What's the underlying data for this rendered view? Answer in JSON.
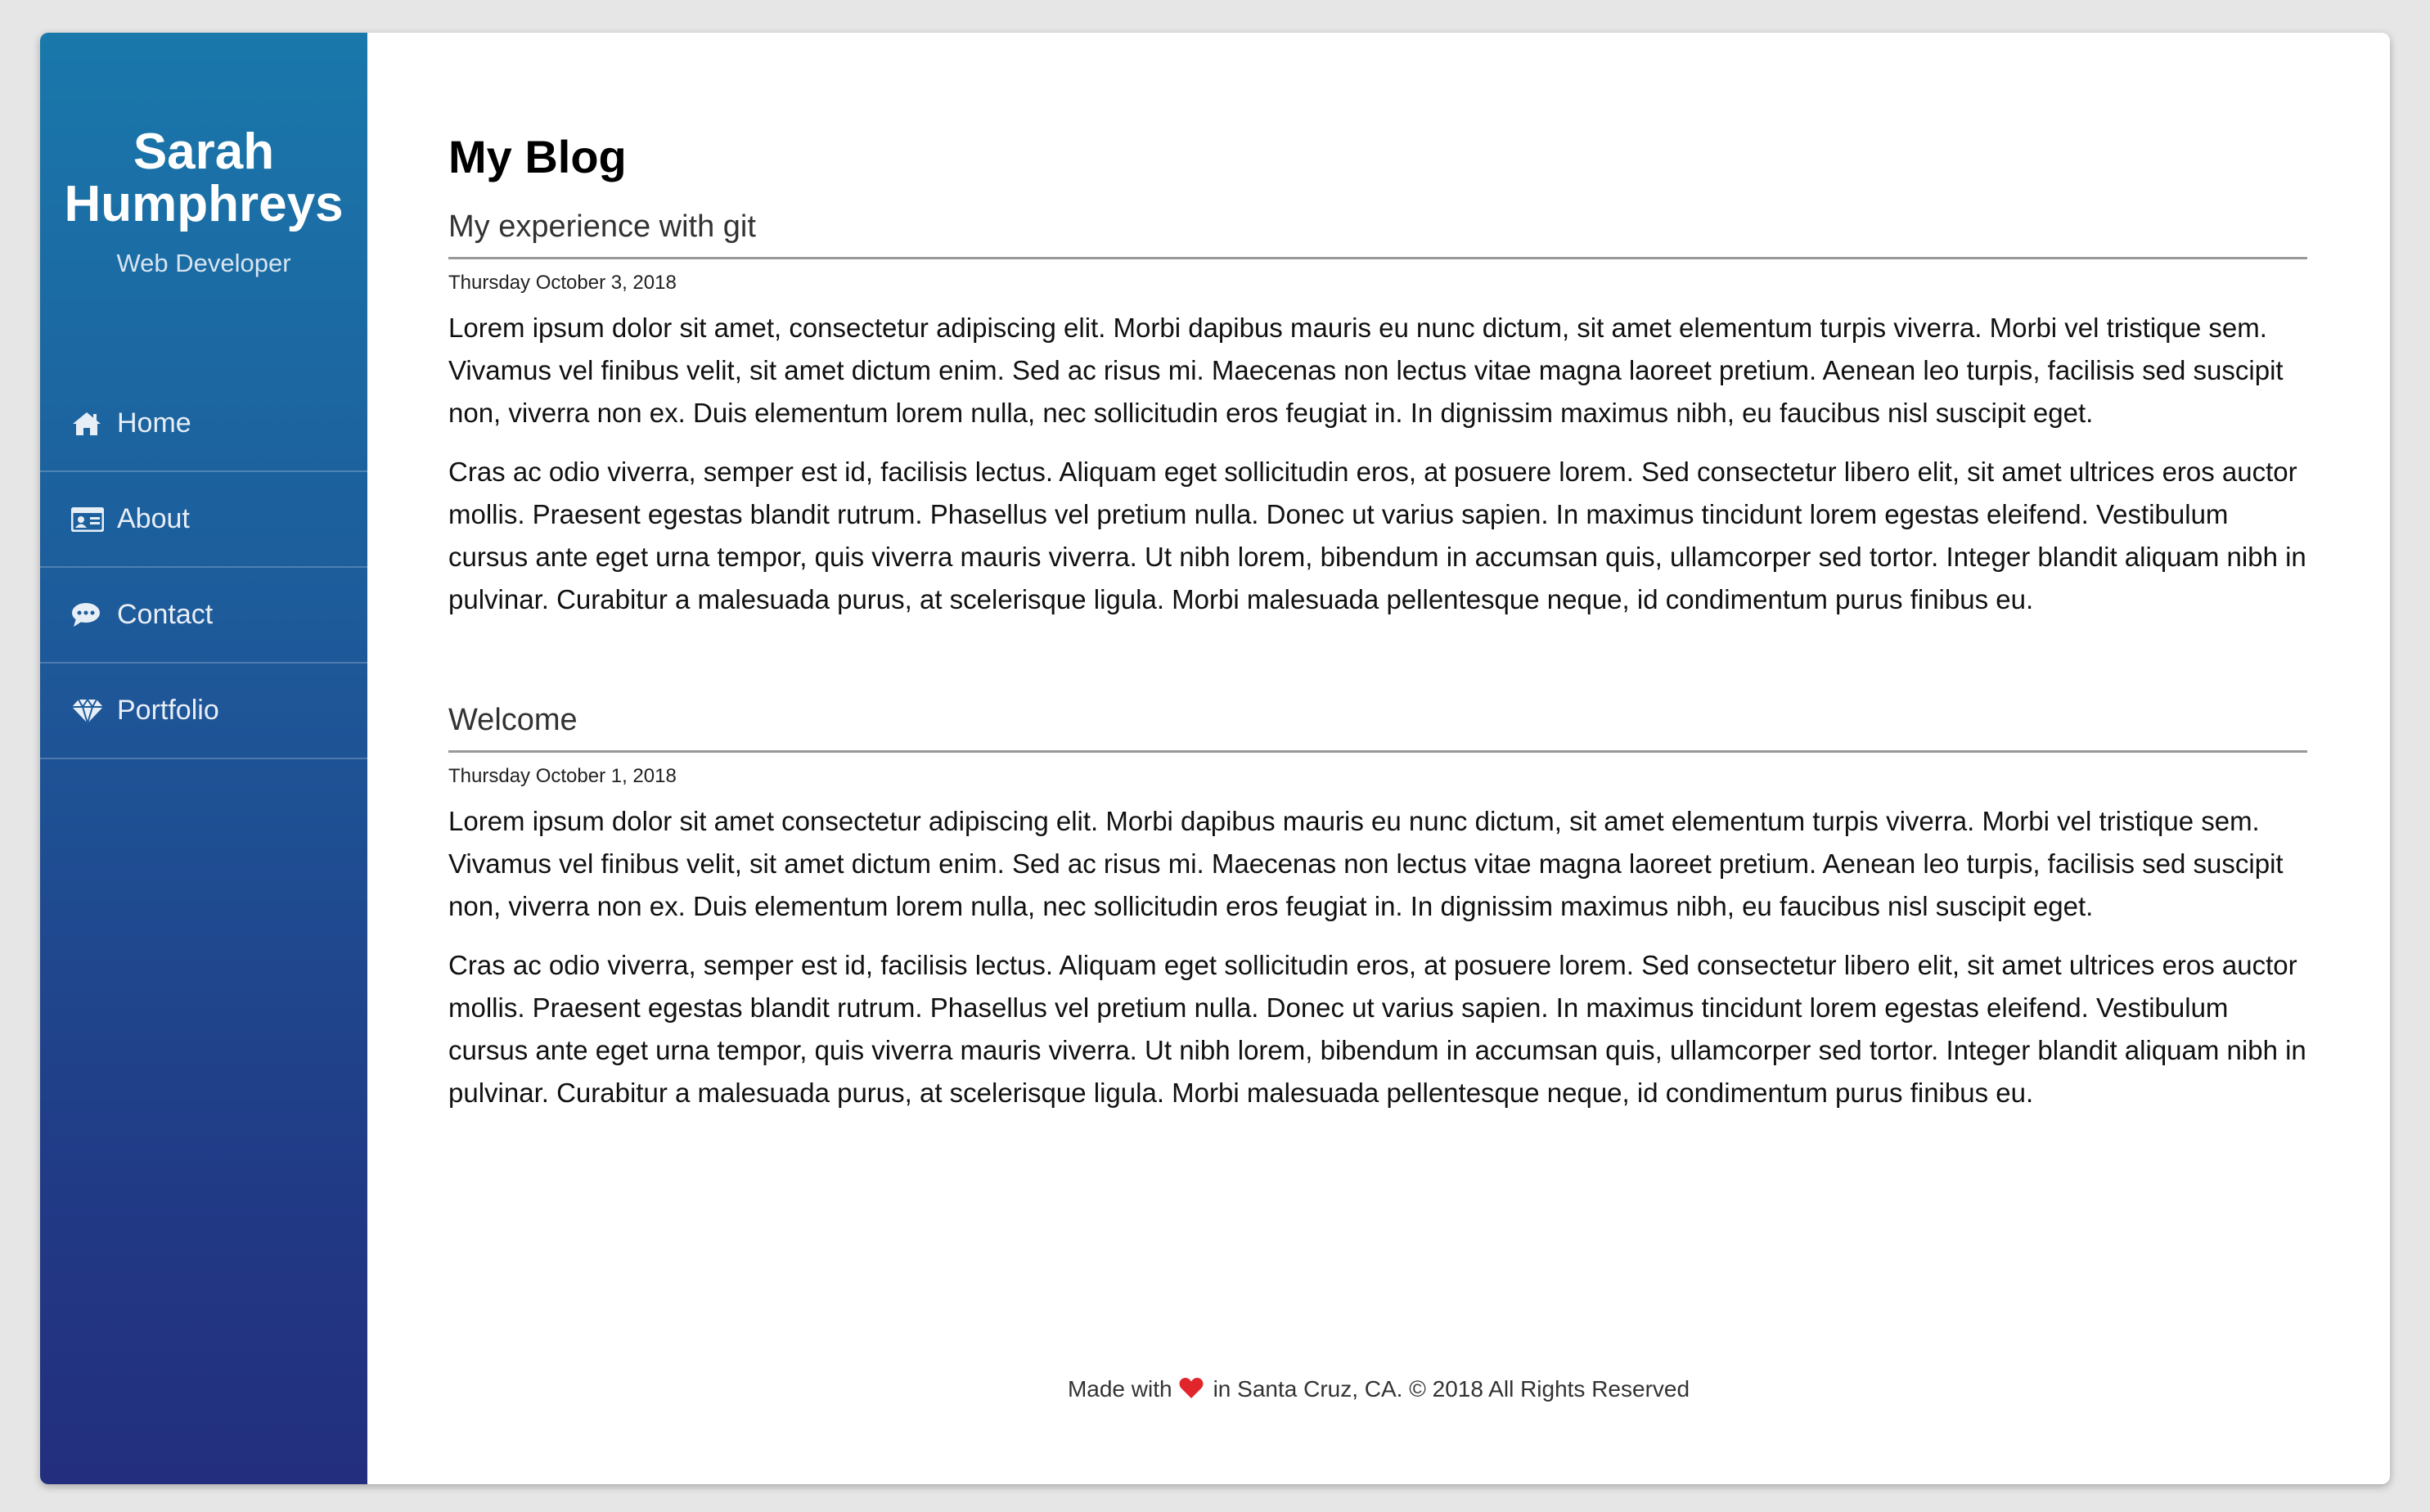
{
  "sidebar": {
    "name_line1": "Sarah",
    "name_line2": "Humphreys",
    "role": "Web Developer",
    "items": [
      {
        "label": "Home",
        "icon": "home-icon"
      },
      {
        "label": "About",
        "icon": "id-card-icon"
      },
      {
        "label": "Contact",
        "icon": "chat-bubble-icon"
      },
      {
        "label": "Portfolio",
        "icon": "diamond-icon"
      }
    ]
  },
  "main": {
    "title": "My Blog",
    "posts": [
      {
        "title": "My experience with git",
        "date": "Thursday October 3, 2018",
        "paragraphs": [
          "Lorem ipsum dolor sit amet, consectetur adipiscing elit. Morbi dapibus mauris eu nunc dictum, sit amet elementum turpis viverra. Morbi vel tristique sem. Vivamus vel finibus velit, sit amet dictum enim. Sed ac risus mi. Maecenas non lectus vitae magna laoreet pretium. Aenean leo turpis, facilisis sed suscipit non, viverra non ex. Duis elementum lorem nulla, nec sollicitudin eros feugiat in. In dignissim maximus nibh, eu faucibus nisl suscipit eget.",
          "Cras ac odio viverra, semper est id, facilisis lectus. Aliquam eget sollicitudin eros, at posuere lorem. Sed consectetur libero elit, sit amet ultrices eros auctor mollis. Praesent egestas blandit rutrum. Phasellus vel pretium nulla. Donec ut varius sapien. In maximus tincidunt lorem egestas eleifend. Vestibulum cursus ante eget urna tempor, quis viverra mauris viverra. Ut nibh lorem, bibendum in accumsan quis, ullamcorper sed tortor. Integer blandit aliquam nibh in pulvinar. Curabitur a malesuada purus, at scelerisque ligula. Morbi malesuada pellentesque neque, id condimentum purus finibus eu."
        ]
      },
      {
        "title": "Welcome",
        "date": "Thursday October 1, 2018",
        "paragraphs": [
          "Lorem ipsum dolor sit amet consectetur adipiscing elit. Morbi dapibus mauris eu nunc dictum, sit amet elementum turpis viverra. Morbi vel tristique sem. Vivamus vel finibus velit, sit amet dictum enim. Sed ac risus mi. Maecenas non lectus vitae magna laoreet pretium. Aenean leo turpis, facilisis sed suscipit non, viverra non ex. Duis elementum lorem nulla, nec sollicitudin eros feugiat in. In dignissim maximus nibh, eu faucibus nisl suscipit eget.",
          "Cras ac odio viverra, semper est id, facilisis lectus. Aliquam eget sollicitudin eros, at posuere lorem. Sed consectetur libero elit, sit amet ultrices eros auctor mollis. Praesent egestas blandit rutrum. Phasellus vel pretium nulla. Donec ut varius sapien. In maximus tincidunt lorem egestas eleifend. Vestibulum cursus ante eget urna tempor, quis viverra mauris viverra. Ut nibh lorem, bibendum in accumsan quis, ullamcorper sed tortor. Integer blandit aliquam nibh in pulvinar. Curabitur a malesuada purus, at scelerisque ligula. Morbi malesuada pellentesque neque, id condimentum purus finibus eu."
        ]
      }
    ]
  },
  "footer": {
    "before": "Made with",
    "after": "in Santa Cruz, CA. © 2018 All Rights Reserved",
    "heart_color": "#e0262b"
  },
  "colors": {
    "sidebar_top": "#1a78ab",
    "sidebar_bottom": "#232e7e"
  }
}
